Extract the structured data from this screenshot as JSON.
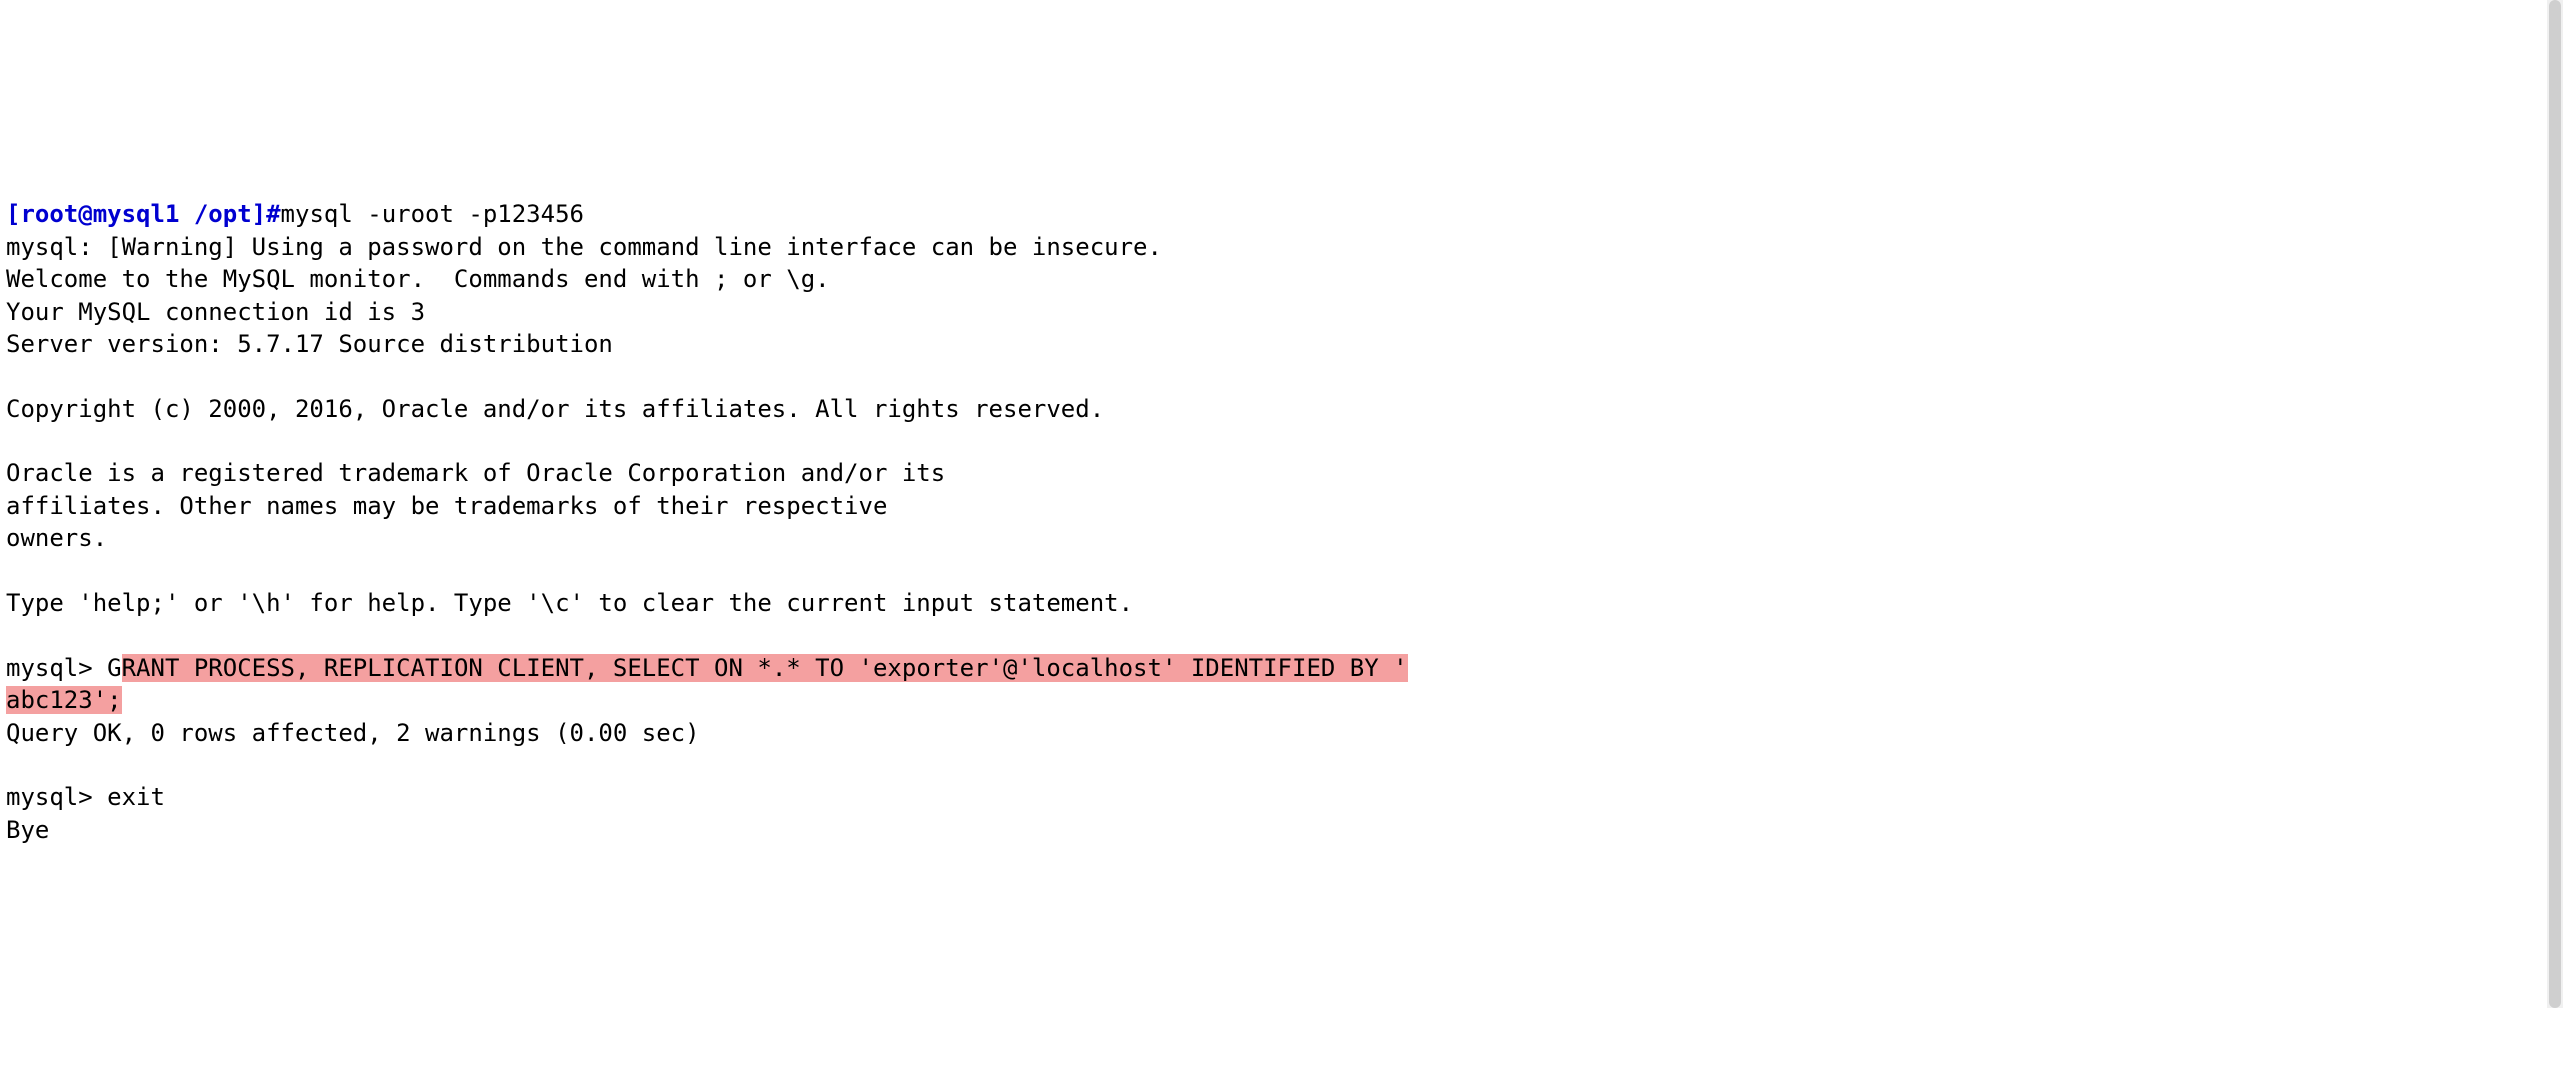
{
  "prompt": {
    "user_host": "[root@mysql1 ",
    "cwd": "/opt]",
    "hash": "#"
  },
  "shell_cmd": "mysql -uroot -p123456",
  "lines": {
    "warn": "mysql: [Warning] Using a password on the command line interface can be insecure.",
    "welcome": "Welcome to the MySQL monitor.  Commands end with ; or \\g.",
    "conn_id": "Your MySQL connection id is 3",
    "version": "Server version: 5.7.17 Source distribution",
    "blank": "",
    "copyright": "Copyright (c) 2000, 2016, Oracle and/or its affiliates. All rights reserved.",
    "trademark1": "Oracle is a registered trademark of Oracle Corporation and/or its",
    "trademark2": "affiliates. Other names may be trademarks of their respective",
    "trademark3": "owners.",
    "help": "Type 'help;' or '\\h' for help. Type '\\c' to clear the current input statement."
  },
  "mysql": {
    "prompt": "mysql> ",
    "grant_pre": "G",
    "grant_hl1": "RANT PROCESS, REPLICATION CLIENT, SELECT ON *.* TO 'exporter'@'localhost' IDENTIFIED BY '",
    "grant_hl2": "abc123';",
    "query_ok": "Query OK, 0 rows affected, 2 warnings (0.00 sec)",
    "exit_cmd": "exit",
    "bye": "Bye"
  }
}
